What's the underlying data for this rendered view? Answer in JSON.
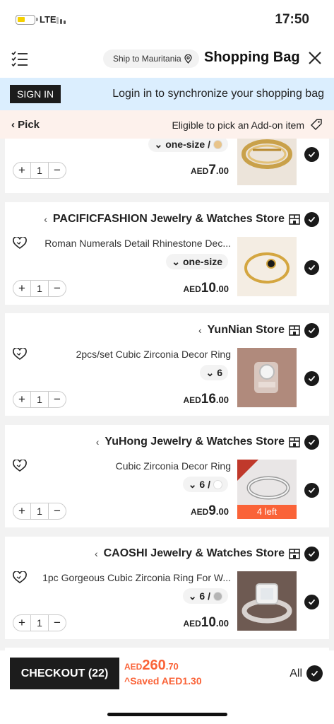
{
  "status_bar": {
    "network": "LTE",
    "time": "17:50"
  },
  "header": {
    "ship_to": "Ship to Mauritania",
    "title": "Shopping Bag"
  },
  "banner": {
    "sign_in": "SIGN IN",
    "message": "Login in to synchronize your shopping bag"
  },
  "pick_bar": {
    "pick": "Pick",
    "eligible": "Eligible to pick an Add-on item"
  },
  "items": [
    {
      "attr": "one-size /",
      "swatch": "#e8c48a",
      "qty": "1",
      "currency": "AED",
      "price_int": "7",
      "price_dec": ".00"
    },
    {
      "store": "PACIFICFASHION Jewelry & Watches Store",
      "name": "Roman Numerals Detail Rhinestone Dec...",
      "attr": "one-size",
      "qty": "1",
      "currency": "AED",
      "price_int": "10",
      "price_dec": ".00"
    },
    {
      "store": "YunNian Store",
      "name": "2pcs/set Cubic Zirconia Decor Ring",
      "attr": "6",
      "qty": "1",
      "currency": "AED",
      "price_int": "16",
      "price_dec": ".00"
    },
    {
      "store": "YuHong Jewelry & Watches Store",
      "name": "Cubic Zirconia Decor Ring",
      "attr": "6 /",
      "swatch": "#ffffff",
      "qty": "1",
      "currency": "AED",
      "price_int": "9",
      "price_dec": ".00",
      "badge": "4 left"
    },
    {
      "store": "CAOSHI Jewelry & Watches Store",
      "name": "1pc Gorgeous Cubic Zirconia Ring For W...",
      "attr": "6 /",
      "swatch": "#b5b5b5",
      "qty": "1",
      "currency": "AED",
      "price_int": "10",
      "price_dec": ".00"
    }
  ],
  "footer": {
    "checkout": "CHECKOUT (22)",
    "currency": "AED",
    "total_int": "260",
    "total_dec": ".70",
    "saved": "Saved AED1.30",
    "all": "All"
  },
  "colors": {
    "accent": "#fa6338",
    "banner": "#dbeefe",
    "pick_bar": "#fdf1ec",
    "dark": "#1c1c1c"
  }
}
